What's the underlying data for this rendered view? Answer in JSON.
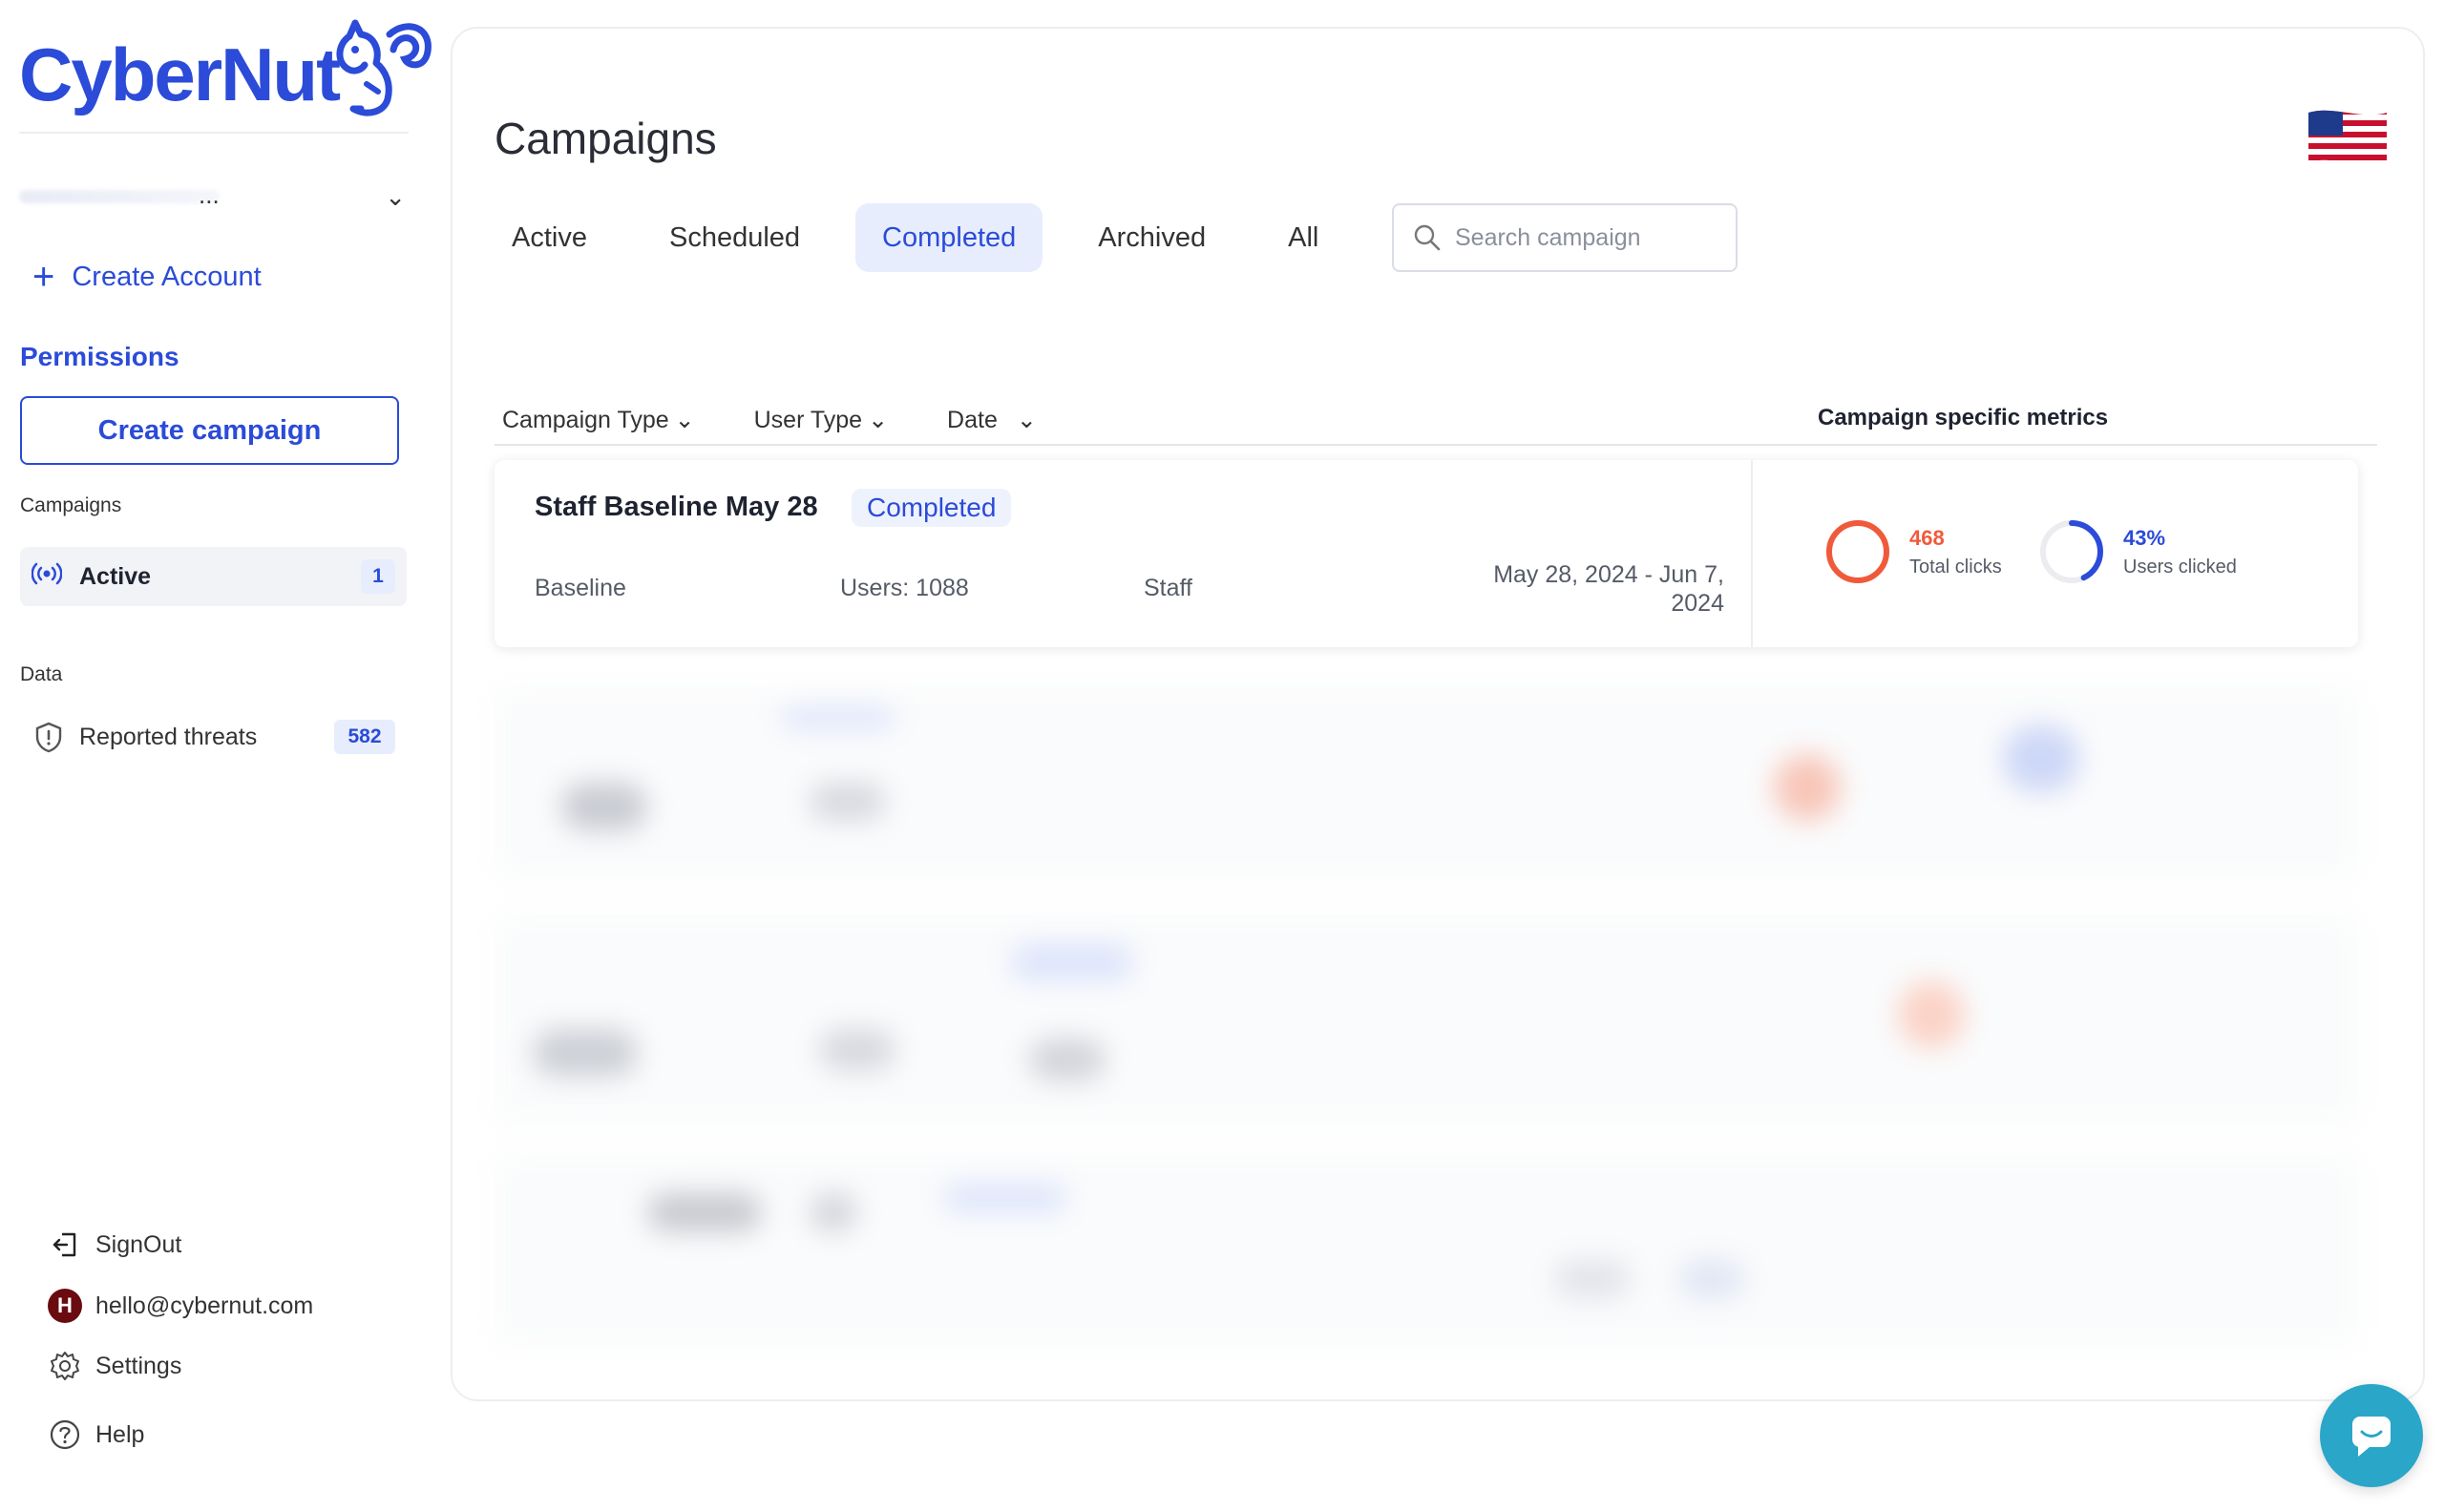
{
  "brand": {
    "name": "CyberNut"
  },
  "sidebar": {
    "account_selector": {
      "value": "..."
    },
    "create_account": "Create Account",
    "permissions": "Permissions",
    "create_campaign": "Create campaign",
    "campaigns_label": "Campaigns",
    "active": {
      "label": "Active",
      "count": "1"
    },
    "data_label": "Data",
    "reported_threats": {
      "label": "Reported threats",
      "count": "582"
    },
    "bottom": {
      "signout": "SignOut",
      "email": "hello@cybernut.com",
      "avatar_initial": "H",
      "settings": "Settings",
      "help": "Help"
    }
  },
  "main": {
    "title": "Campaigns",
    "tabs": [
      {
        "label": "Active",
        "selected": false
      },
      {
        "label": "Scheduled",
        "selected": false
      },
      {
        "label": "Completed",
        "selected": true
      },
      {
        "label": "Archived",
        "selected": false
      },
      {
        "label": "All",
        "selected": false
      }
    ],
    "search": {
      "placeholder": "Search campaign",
      "value": ""
    },
    "filters": {
      "campaign_type": "Campaign Type",
      "user_type": "User Type",
      "date": "Date"
    },
    "metrics_header": "Campaign specific metrics",
    "campaigns": [
      {
        "title": "Staff Baseline May 28",
        "status": "Completed",
        "type": "Baseline",
        "users": "Users: 1088",
        "user_type": "Staff",
        "date_range": "May 28, 2024 - Jun 7, 2024",
        "total_clicks": {
          "value": "468",
          "label": "Total clicks",
          "fraction": 1.0
        },
        "users_clicked": {
          "value": "43%",
          "label": "Users clicked",
          "fraction": 0.43
        }
      }
    ]
  },
  "colors": {
    "accent": "#2b4bd8",
    "danger": "#f05a3a",
    "chat": "#2aa6c8"
  }
}
